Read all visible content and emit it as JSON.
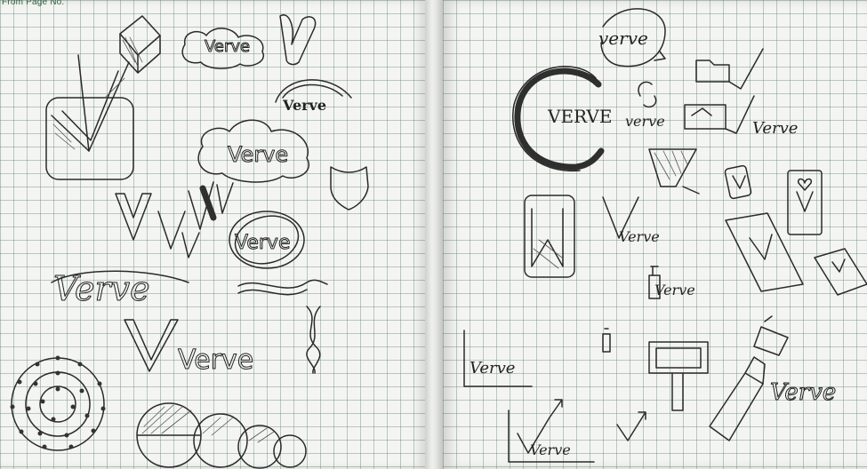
{
  "notebook": {
    "header_label": "From Page No.",
    "left_page": {
      "wordmarks": [
        "Verve",
        "Verve",
        "Verve",
        "Verve",
        "Verve",
        "Verve"
      ]
    },
    "right_page": {
      "wordmarks": [
        "verve",
        "VERVE",
        "verve",
        "Verve",
        "Verve",
        "Verve",
        "Verve",
        "Verve",
        "Verve"
      ]
    }
  }
}
